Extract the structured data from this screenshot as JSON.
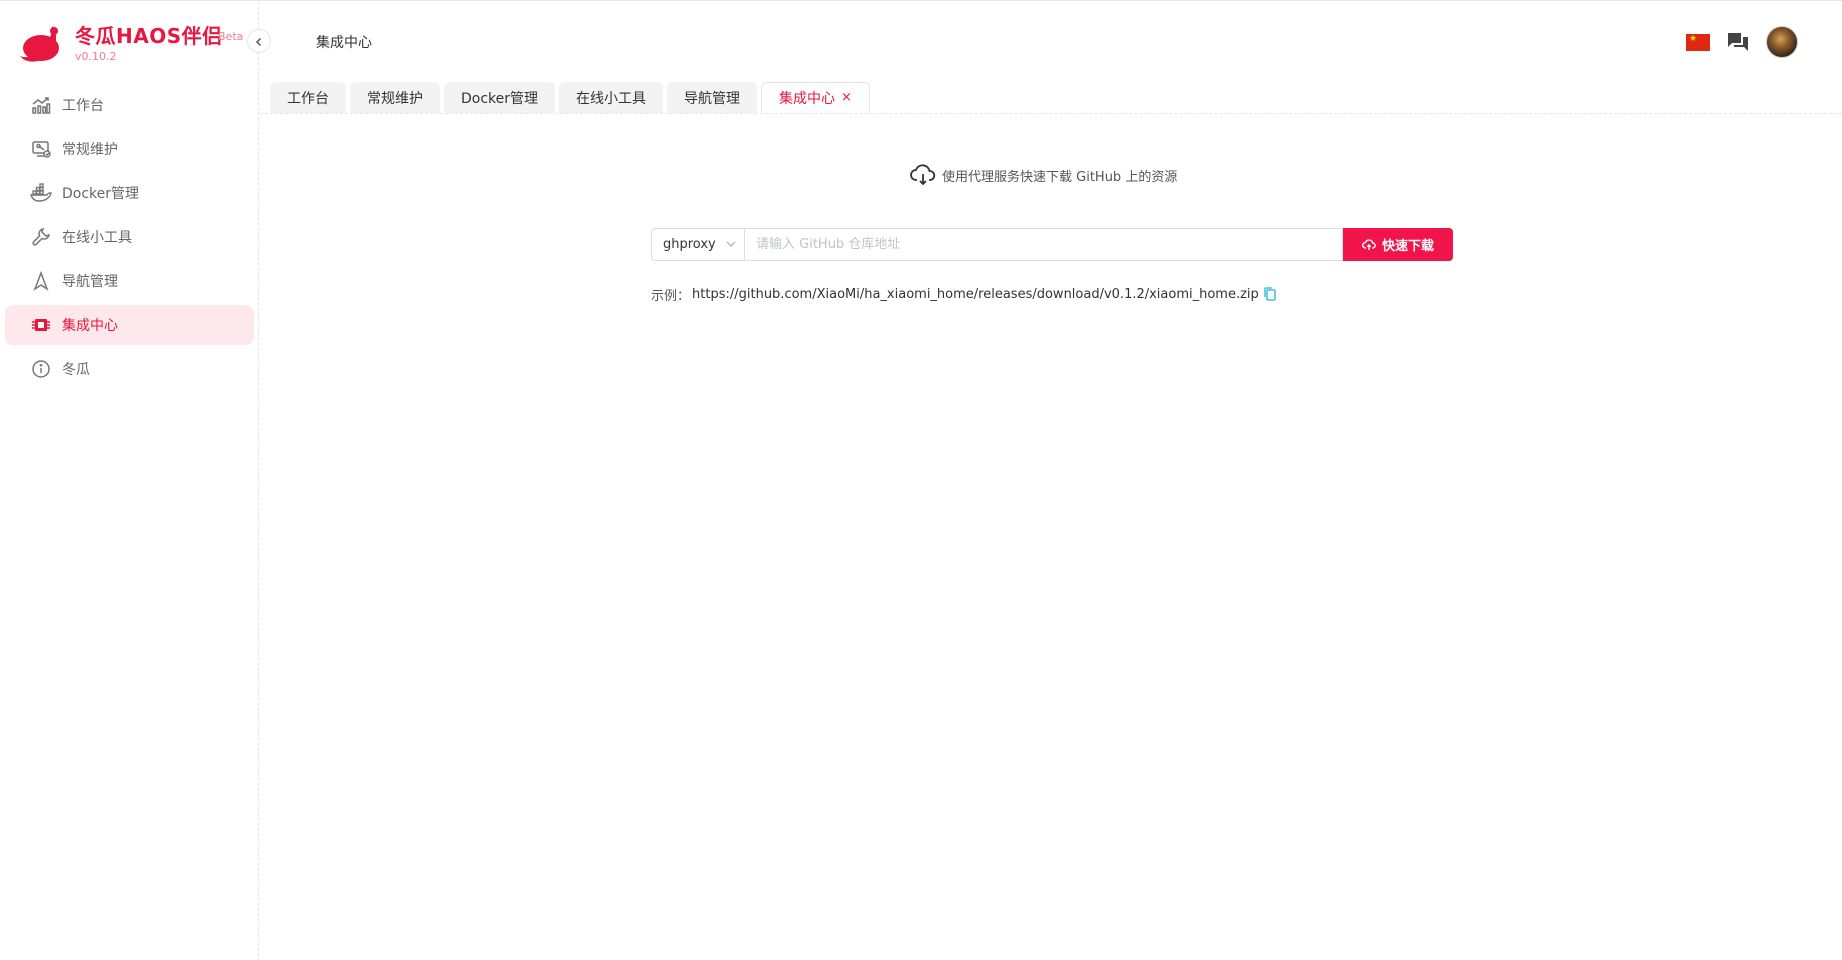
{
  "brand": {
    "name": "冬瓜HAOS伴侣",
    "beta": "Beta",
    "version": "v0.10.2"
  },
  "sidebar": {
    "items": [
      {
        "label": "工作台",
        "icon": "chart-icon"
      },
      {
        "label": "常规维护",
        "icon": "maintenance-icon"
      },
      {
        "label": "Docker管理",
        "icon": "docker-icon"
      },
      {
        "label": "在线小工具",
        "icon": "wrench-icon"
      },
      {
        "label": "导航管理",
        "icon": "navigation-icon"
      },
      {
        "label": "集成中心",
        "icon": "integration-icon",
        "active": true
      },
      {
        "label": "冬瓜",
        "icon": "info-icon"
      }
    ]
  },
  "header": {
    "breadcrumb": "集成中心",
    "language_flag": "china-flag-icon"
  },
  "tabs": [
    {
      "label": "工作台"
    },
    {
      "label": "常规维护"
    },
    {
      "label": "Docker管理"
    },
    {
      "label": "在线小工具"
    },
    {
      "label": "导航管理"
    },
    {
      "label": "集成中心",
      "active": true,
      "close": "×"
    }
  ],
  "main": {
    "title": "使用代理服务快速下载 GitHub 上的资源",
    "proxy": "ghproxy",
    "url_placeholder": "请输入 GitHub 仓库地址",
    "url_value": "",
    "download_button": "快速下载",
    "example_label": "示例：",
    "example_url": "https://github.com/XiaoMi/ha_xiaomi_home/releases/download/v0.1.2/xiaomi_home.zip"
  },
  "colors": {
    "accent": "#e8173f",
    "active_bg": "#fde9ec",
    "button": "#f0144b"
  }
}
